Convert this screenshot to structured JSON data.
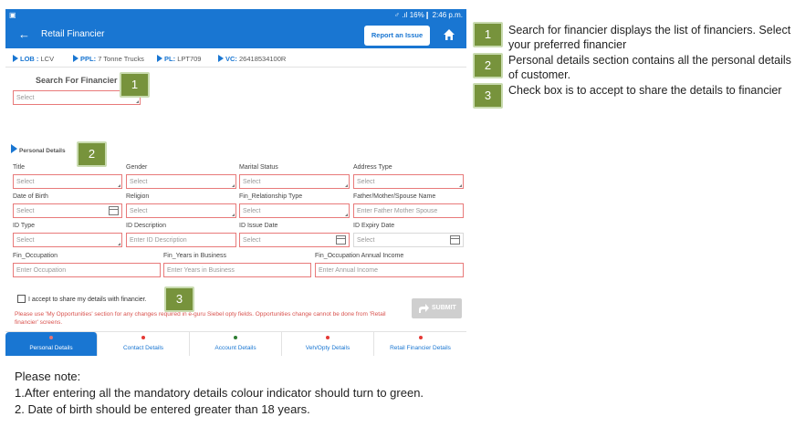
{
  "status_bar": {
    "left_icon": "screenshot-icon",
    "right": "♂ .ıl 16%❙ 2:46 p.m."
  },
  "app_bar": {
    "back": "←",
    "title": "Retail Financier",
    "report_button": "Report an Issue",
    "home_icon": "home-icon"
  },
  "breadcrumb": [
    {
      "key": "LOB :",
      "value": "LCV"
    },
    {
      "key": "PPL:",
      "value": "7 Tonne Trucks"
    },
    {
      "key": "PL:",
      "value": "LPT709"
    },
    {
      "key": "VC:",
      "value": "26418534100R"
    }
  ],
  "search": {
    "title": "Search For Financier",
    "placeholder": "Select"
  },
  "personal_details": {
    "header": "Personal Details",
    "fields": {
      "title": {
        "label": "Title",
        "placeholder": "Select"
      },
      "gender": {
        "label": "Gender",
        "placeholder": "Select"
      },
      "marital_status": {
        "label": "Marital Status",
        "placeholder": "Select"
      },
      "address_type": {
        "label": "Address Type",
        "placeholder": "Select"
      },
      "dob": {
        "label": "Date of Birth",
        "placeholder": "Select"
      },
      "religion": {
        "label": "Religion",
        "placeholder": "Select"
      },
      "fin_relationship": {
        "label": "Fin_Relationship Type",
        "placeholder": "Select"
      },
      "father_name": {
        "label": "Father/Mother/Spouse Name",
        "placeholder": "Enter Father Mother Spouse"
      },
      "id_type": {
        "label": "ID Type",
        "placeholder": "Select"
      },
      "id_description": {
        "label": "ID Description",
        "placeholder": "Enter ID Description"
      },
      "id_issue_date": {
        "label": "ID Issue Date",
        "placeholder": "Select"
      },
      "id_expiry_date": {
        "label": "ID Expiry Date",
        "placeholder": "Select"
      },
      "occupation": {
        "label": "Fin_Occupation",
        "placeholder": "Enter Occupation"
      },
      "years_in_business": {
        "label": "Fin_Years in Business",
        "placeholder": "Enter Years in Business"
      },
      "annual_income": {
        "label": "Fin_Occupation Annual Income",
        "placeholder": "Enter Annual Income"
      }
    }
  },
  "consent": {
    "label": "I accept to share my details with financier."
  },
  "warning": "Please use 'My Opportunities' section for any changes required in e-guru Siebel opty fields. Opportunities change cannot be done from 'Retail financier' screens.",
  "submit": "SUBMIT",
  "tabs": [
    {
      "label": "Personal Details",
      "status_color": "#e57373",
      "active": true
    },
    {
      "label": "Contact Details",
      "status_color": "#e53935",
      "active": false
    },
    {
      "label": "Account Details",
      "status_color": "#2e7d32",
      "active": false
    },
    {
      "label": "Veh/Opty Details",
      "status_color": "#e53935",
      "active": false
    },
    {
      "label": "Retail Financier Details",
      "status_color": "#e53935",
      "active": false
    }
  ],
  "callouts": [
    {
      "number": "1",
      "text": "Search for financier displays the list of financiers. Select your preferred financier"
    },
    {
      "number": "2",
      "text": "Personal details section contains all the personal details of customer."
    },
    {
      "number": "3",
      "text": "Check box is to accept to share the details to financier"
    }
  ],
  "notes": {
    "title": "Please note:",
    "items": [
      "1.After entering all the mandatory details colour indicator should turn to green.",
      "2. Date of birth should be entered greater than 18 years."
    ]
  },
  "colors": {
    "primary": "#1976d2",
    "callout": "#77933c",
    "field_border": "#e87a7a",
    "warning": "#d9534f"
  }
}
